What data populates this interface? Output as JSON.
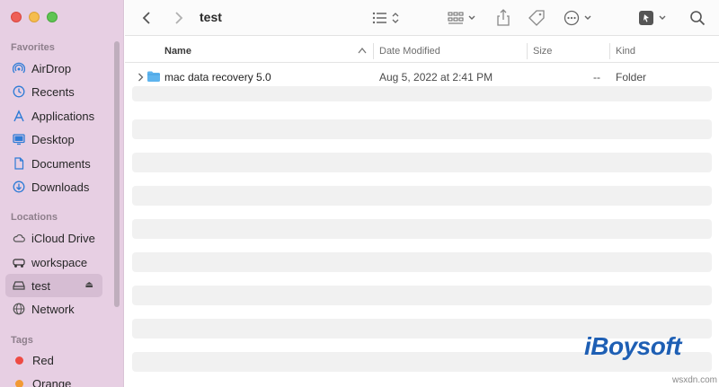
{
  "window": {
    "title": "test"
  },
  "sidebar": {
    "favorites_header": "Favorites",
    "favorites": [
      {
        "label": "AirDrop",
        "icon": "airdrop-icon"
      },
      {
        "label": "Recents",
        "icon": "clock-icon"
      },
      {
        "label": "Applications",
        "icon": "applications-icon"
      },
      {
        "label": "Desktop",
        "icon": "desktop-icon"
      },
      {
        "label": "Documents",
        "icon": "document-icon"
      },
      {
        "label": "Downloads",
        "icon": "download-icon"
      }
    ],
    "locations_header": "Locations",
    "locations": [
      {
        "label": "iCloud Drive",
        "icon": "cloud-icon"
      },
      {
        "label": "workspace",
        "icon": "network-drive-icon"
      },
      {
        "label": "test",
        "icon": "disk-icon",
        "selected": true,
        "eject": "⏏"
      },
      {
        "label": "Network",
        "icon": "network-globe-icon"
      }
    ],
    "tags_header": "Tags",
    "tags": [
      {
        "label": "Red",
        "color": "#ee4b44"
      },
      {
        "label": "Orange",
        "color": "#f29a35"
      }
    ]
  },
  "columns": {
    "name": "Name",
    "date": "Date Modified",
    "size": "Size",
    "kind": "Kind"
  },
  "files": [
    {
      "name": "mac data recovery 5.0",
      "date": "Aug 5, 2022 at 2:41 PM",
      "size": "--",
      "kind": "Folder",
      "icon": "folder-icon"
    }
  ],
  "watermark": {
    "brand": "iBoysoft",
    "site": "wsxdn.com"
  },
  "colors": {
    "accent": "#2d7bd6",
    "sidebar_bg": "#e7cfe3",
    "folder": "#5eb4ee"
  }
}
